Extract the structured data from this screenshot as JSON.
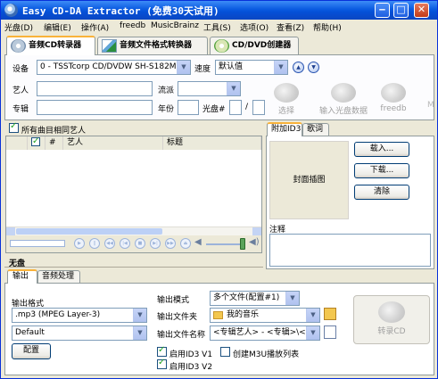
{
  "window": {
    "title": "Easy CD-DA Extractor (免费30天试用)"
  },
  "menu": [
    "光盘(D)",
    "编辑(E)",
    "操作(A)",
    "freedb",
    "MusicBrainz",
    "工具(S)",
    "选项(O)",
    "查看(Z)",
    "帮助(H)"
  ],
  "tabs": [
    "音频CD转录器",
    "音频文件格式转换器",
    "CD/DVD创建器"
  ],
  "device": {
    "label": "设备",
    "value": "0 - TSSTcorp CD/DVDW SH-S182M SB00",
    "speed_label": "速度",
    "speed_value": "默认值"
  },
  "album": {
    "artist_label": "艺人",
    "album_label": "专辑",
    "genre_label": "流派",
    "year_label": "年份",
    "disc_label": "光盘#",
    "disc_sep": "/"
  },
  "toolbar": {
    "select": "选择",
    "input_cd_data": "输入光盘数据",
    "freedb": "freedb"
  },
  "tracks": {
    "same_artist_label": "所有曲目相同艺人",
    "columns": [
      "#",
      "艺人",
      "标题"
    ],
    "disc_label": "无盘"
  },
  "id3": {
    "tabs": [
      "附加ID3",
      "歌词"
    ],
    "cover_label": "封面插图",
    "load_button": "载入...",
    "download_button": "下载...",
    "clear_button": "清除",
    "comment_label": "注释"
  },
  "output": {
    "tabs": [
      "输出",
      "音频处理"
    ],
    "format_label": "输出格式",
    "format_value": ".mp3 (MPEG Layer-3)",
    "preset_value": "Default",
    "config_button": "配置",
    "mode_label": "输出模式",
    "mode_value": "多个文件(配置#1)",
    "folder_label": "输出文件夹",
    "folder_value": "我的音乐",
    "filename_label": "输出文件名称",
    "filename_value": "<专辑艺人> - <专辑>\\<编",
    "id3v1_label": "启用ID3 V1",
    "id3v2_label": "启用ID3 V2",
    "m3u_label": "创建M3U播放列表",
    "rip_button": "转录CD"
  }
}
